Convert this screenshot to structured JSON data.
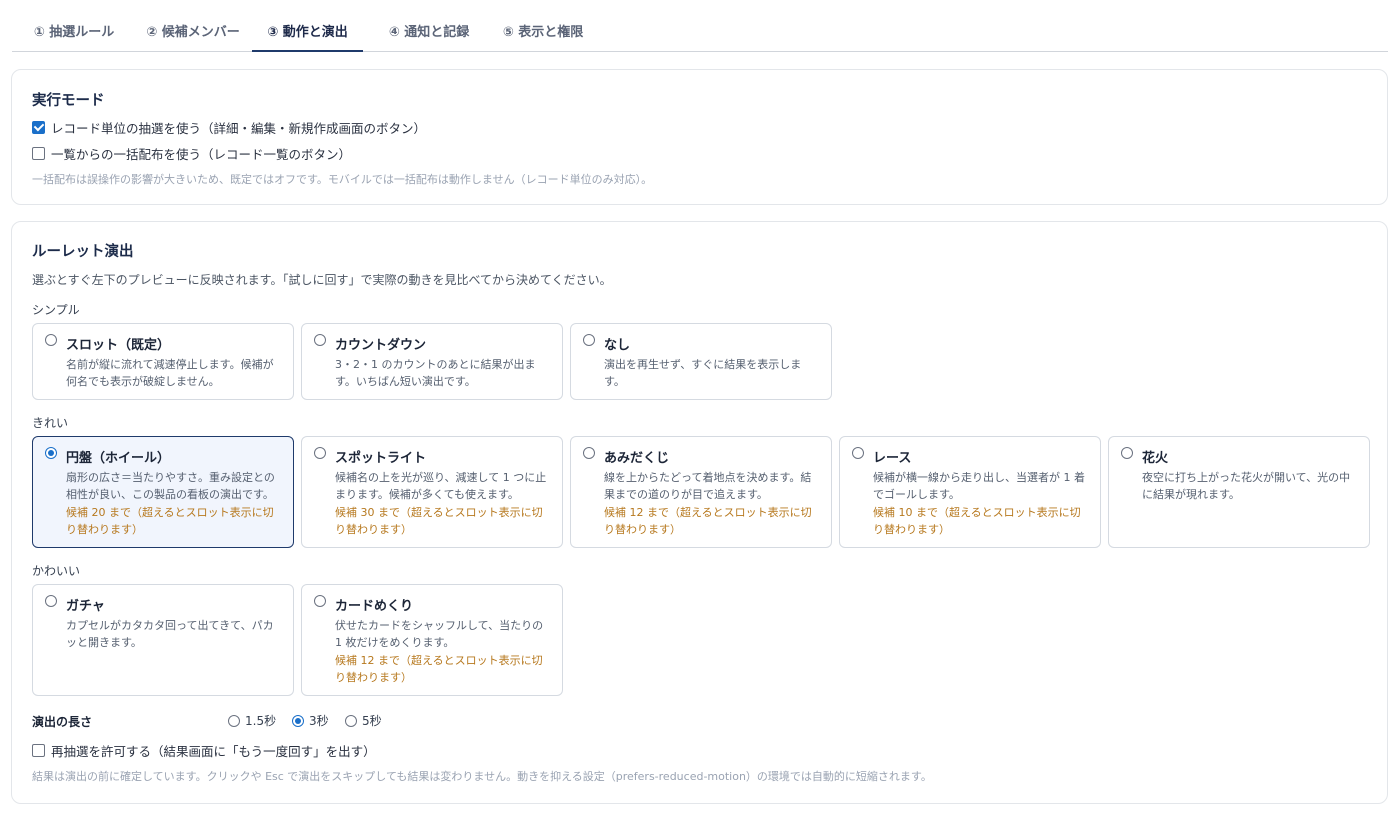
{
  "tabs": [
    {
      "label": "① 抽選ルール"
    },
    {
      "label": "② 候補メンバー"
    },
    {
      "label": "③ 動作と演出"
    },
    {
      "label": "④ 通知と記録"
    },
    {
      "label": "⑤ 表示と権限"
    }
  ],
  "active_tab": "③ 動作と演出",
  "mode": {
    "title": "実行モード",
    "record_option": {
      "label": "レコード単位の抽選を使う（詳細・編集・新規作成画面のボタン）",
      "checked": true
    },
    "bulk_option": {
      "label": "一覧からの一括配布を使う（レコード一覧のボタン）",
      "checked": false
    },
    "note": "一括配布は誤操作の影響が大きいため、既定ではオフです。モバイルでは一括配布は動作しません（レコード単位のみ対応）。"
  },
  "roulette": {
    "title": "ルーレット演出",
    "description": "選ぶとすぐ左下のプレビューに反映されます。「試しに回す」で実際の動きを見比べてから決めてください。",
    "groups": {
      "simple": {
        "label": "シンプル",
        "options": [
          {
            "title": "スロット（既定）",
            "body": "名前が縦に流れて減速停止します。候補が何名でも表示が破綻しません。",
            "note": "",
            "selected": false
          },
          {
            "title": "カウントダウン",
            "body": "3・2・1 のカウントのあとに結果が出ます。いちばん短い演出です。",
            "note": "",
            "selected": false
          },
          {
            "title": "なし",
            "body": "演出を再生せず、すぐに結果を表示します。",
            "note": "",
            "selected": false
          }
        ]
      },
      "pretty": {
        "label": "きれい",
        "options": [
          {
            "title": "円盤（ホイール）",
            "body": "扇形の広さ＝当たりやすさ。重み設定との相性が良い、この製品の看板の演出です。",
            "note": "候補 20 まで（超えるとスロット表示に切り替わります）",
            "selected": true
          },
          {
            "title": "スポットライト",
            "body": "候補名の上を光が巡り、減速して 1 つに止まります。候補が多くても使えます。",
            "note": "候補 30 まで（超えるとスロット表示に切り替わります）",
            "selected": false
          },
          {
            "title": "あみだくじ",
            "body": "線を上からたどって着地点を決めます。結果までの道のりが目で追えます。",
            "note": "候補 12 まで（超えるとスロット表示に切り替わります）",
            "selected": false
          },
          {
            "title": "レース",
            "body": "候補が横一線から走り出し、当選者が 1 着でゴールします。",
            "note": "候補 10 まで（超えるとスロット表示に切り替わります）",
            "selected": false
          },
          {
            "title": "花火",
            "body": "夜空に打ち上がった花火が開いて、光の中に結果が現れます。",
            "note": "",
            "selected": false
          }
        ]
      },
      "cute": {
        "label": "かわいい",
        "options": [
          {
            "title": "ガチャ",
            "body": "カプセルがカタカタ回って出てきて、パカッと開きます。",
            "note": "",
            "selected": false
          },
          {
            "title": "カードめくり",
            "body": "伏せたカードをシャッフルして、当たりの 1 枚だけをめくります。",
            "note": "候補 12 まで（超えるとスロット表示に切り替わります）",
            "selected": false
          }
        ]
      }
    },
    "duration": {
      "label": "演出の長さ",
      "options": [
        {
          "label": "1.5秒",
          "selected": false
        },
        {
          "label": "3秒",
          "selected": true
        },
        {
          "label": "5秒",
          "selected": false
        }
      ]
    },
    "redraw": {
      "label": "再抽選を許可する（結果画面に「もう一度回す」を出す）",
      "checked": false
    },
    "footer_note": "結果は演出の前に確定しています。クリックや Esc で演出をスキップしても結果は変わりません。動きを抑える設定（prefers-reduced-motion）の環境では自動的に短縮されます。"
  },
  "colors": {
    "accent": "#1a6fc9",
    "active_tab": "#1f3a6b",
    "warning_note": "#b7791f",
    "selected_card_bg": "#f1f5fd"
  }
}
